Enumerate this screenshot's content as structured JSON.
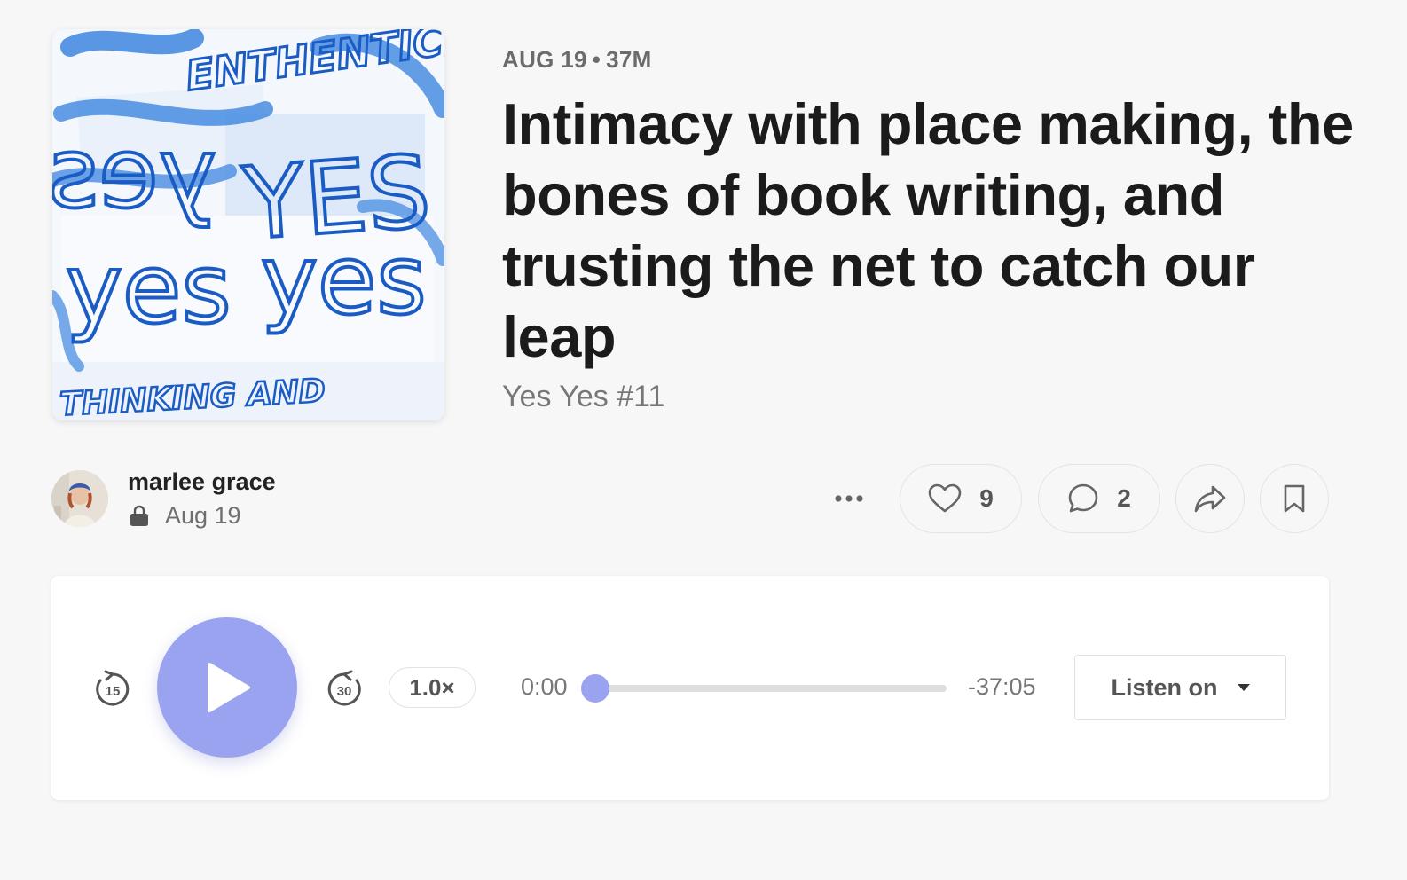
{
  "episode": {
    "date": "AUG 19",
    "separator": "•",
    "duration": "37M",
    "title": "Intimacy with place making, the bones of book writing, and trusting the net to catch our leap",
    "subtitle": "Yes Yes #11"
  },
  "cover_art": {
    "words": [
      "YES",
      "yes",
      "yes",
      "yes",
      "YES",
      "ENTHENTIC",
      "THINKING AND"
    ]
  },
  "author": {
    "name": "marlee grace",
    "date": "Aug 19",
    "lock_icon": "lock-icon"
  },
  "actions": {
    "more_icon": "ellipsis-icon",
    "likes": "9",
    "comments": "2",
    "share_icon": "share-arrow-icon",
    "bookmark_icon": "bookmark-icon"
  },
  "player": {
    "skip_back_label": "15",
    "skip_forward_label": "30",
    "speed": "1.0×",
    "elapsed": "0:00",
    "remaining": "-37:05",
    "progress": 0,
    "listen_on": "Listen on",
    "accent_color": "#9aa3f0"
  }
}
